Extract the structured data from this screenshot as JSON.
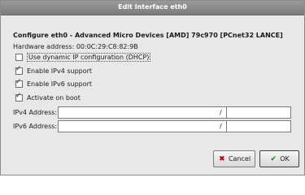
{
  "window": {
    "title": "Edit Interface eth0"
  },
  "header": {
    "device_heading": "Configure eth0 - Advanced Micro Devices [AMD] 79c970 [PCnet32 LANCE]",
    "hardware_address": "Hardware address: 00:0C:29:C8:82:9B"
  },
  "options": {
    "dhcp": {
      "label": "Use dynamic IP configuration (DHCP)",
      "checked": false
    },
    "ipv4": {
      "label": "Enable IPv4 support",
      "checked": true
    },
    "ipv6": {
      "label": "Enable IPv6 support",
      "checked": true
    },
    "onboot": {
      "label": "Activate on boot",
      "checked": true
    }
  },
  "addresses": {
    "ipv4_label": "IPv4 Address:",
    "ipv6_label": "IPv6 Address:",
    "separator": "/",
    "ipv4_value": "",
    "ipv4_prefix": "",
    "ipv6_value": "",
    "ipv6_prefix": ""
  },
  "buttons": {
    "cancel_label": "Cancel",
    "ok_label": "OK"
  },
  "icons": {
    "cancel": "cancel-x-icon",
    "ok": "ok-check-icon",
    "check": "checkmark-icon"
  }
}
